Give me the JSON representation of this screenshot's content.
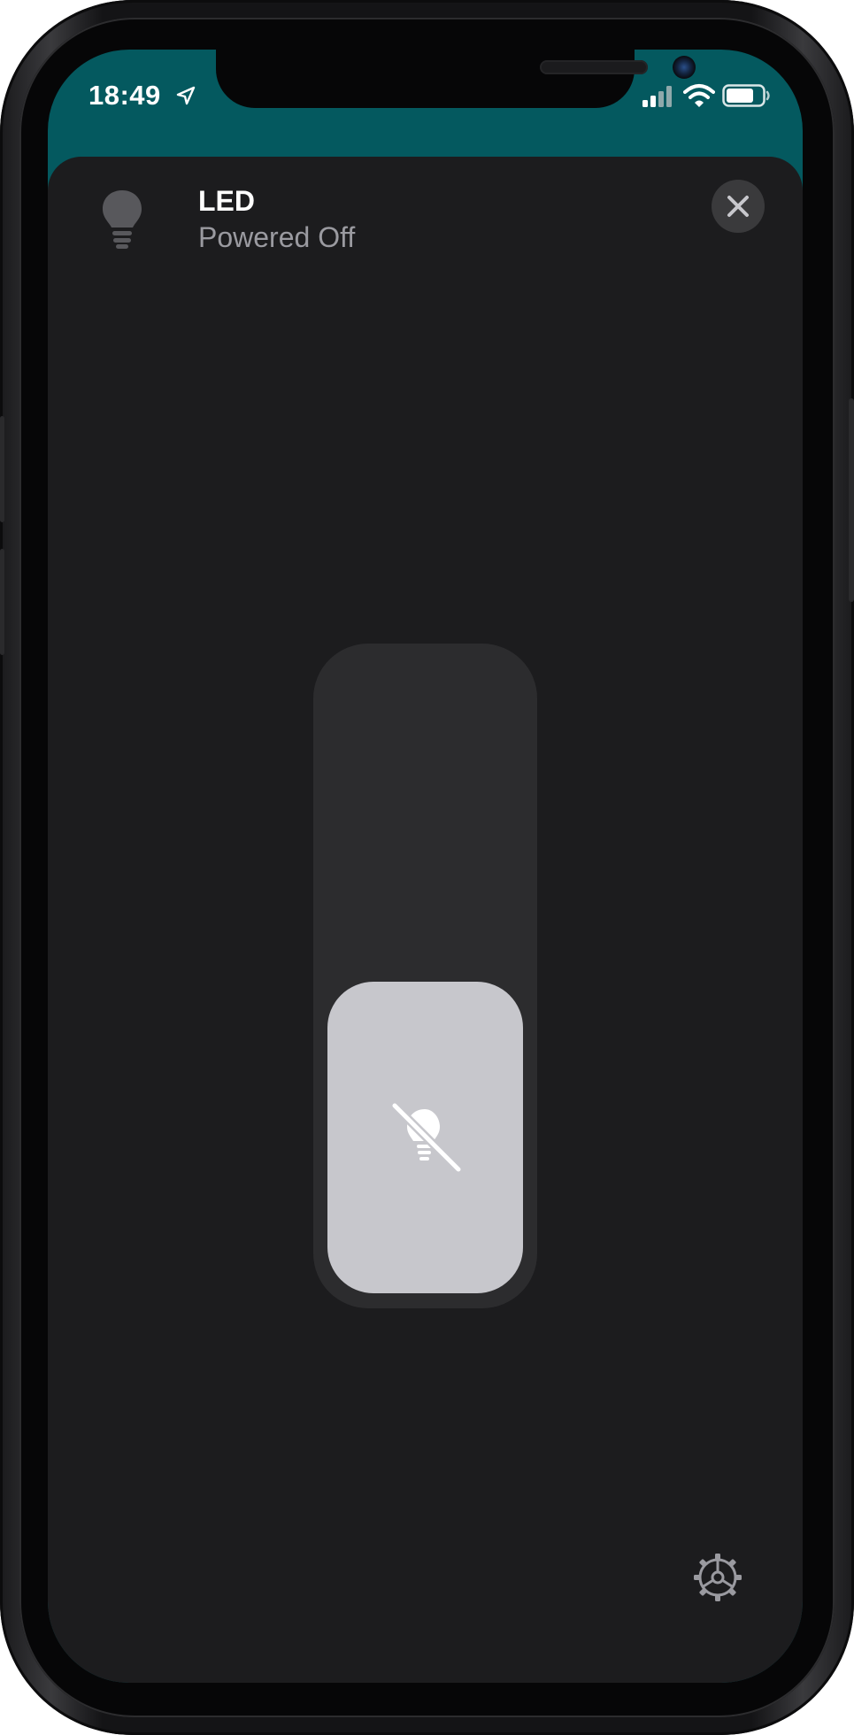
{
  "status_bar": {
    "time": "18:49",
    "location_icon": "location-arrow-icon",
    "signal_icon": "cellular-signal-icon",
    "wifi_icon": "wifi-icon",
    "battery_icon": "battery-icon"
  },
  "accessory": {
    "icon": "lightbulb-icon",
    "name": "LED",
    "status": "Powered Off"
  },
  "controls": {
    "close_icon": "close-icon",
    "brightness_icon": "lightbulb-slash-icon",
    "brightness_level": 0,
    "settings_icon": "gear-icon"
  },
  "colors": {
    "header_background": "#04595f",
    "sheet_background": "#1c1c1e",
    "slider_track": "#2c2c2e",
    "slider_thumb": "#c7c7cc"
  }
}
